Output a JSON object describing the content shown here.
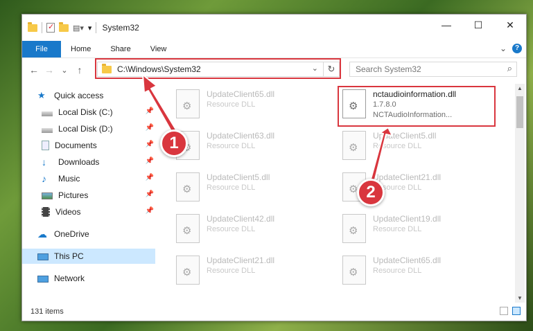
{
  "titlebar": {
    "title": "System32",
    "minimize_glyph": "—",
    "maximize_glyph": "☐",
    "close_glyph": "✕",
    "dropdown_glyph": "▾"
  },
  "ribbon": {
    "file": "File",
    "home": "Home",
    "share": "Share",
    "view": "View",
    "expand_glyph": "⌄",
    "help_glyph": "?"
  },
  "nav_buttons": {
    "back": "←",
    "forward": "→",
    "recent": "⌄",
    "up": "↑"
  },
  "address": {
    "path": "C:\\Windows\\System32",
    "dropdown_glyph": "⌄",
    "refresh_glyph": "↻"
  },
  "search": {
    "placeholder": "Search System32",
    "icon_glyph": "⌕"
  },
  "nav": {
    "quick_access": "Quick access",
    "local_c": "Local Disk (C:)",
    "local_d": "Local Disk (D:)",
    "documents": "Documents",
    "downloads": "Downloads",
    "music": "Music",
    "pictures": "Pictures",
    "videos": "Videos",
    "onedrive": "OneDrive",
    "this_pc": "This PC",
    "network": "Network",
    "pin_glyph": "📌"
  },
  "files": {
    "left": [
      {
        "name": "UpdateClient65.dll",
        "desc": "Resource DLL"
      },
      {
        "name": "UpdateClient63.dll",
        "desc": "Resource DLL"
      },
      {
        "name": "UpdateClient5.dll",
        "desc": "Resource DLL"
      },
      {
        "name": "UpdateClient42.dll",
        "desc": "Resource DLL"
      },
      {
        "name": "UpdateClient21.dll",
        "desc": "Resource DLL"
      }
    ],
    "right": [
      {
        "name": "nctaudioinformation.dll",
        "version": "1.7.8.0",
        "desc": "NCTAudioInformation..."
      },
      {
        "name": "UpdateClient5.dll",
        "desc": "Resource DLL"
      },
      {
        "name": "UpdateClient21.dll",
        "desc": "Resource DLL"
      },
      {
        "name": "UpdateClient19.dll",
        "desc": "Resource DLL"
      },
      {
        "name": "UpdateClient65.dll",
        "desc": "Resource DLL"
      }
    ],
    "icon_glyph": "⚙"
  },
  "status": {
    "count": "131 items"
  },
  "annotations": {
    "step1": "1",
    "step2": "2",
    "color": "#d9363e"
  }
}
